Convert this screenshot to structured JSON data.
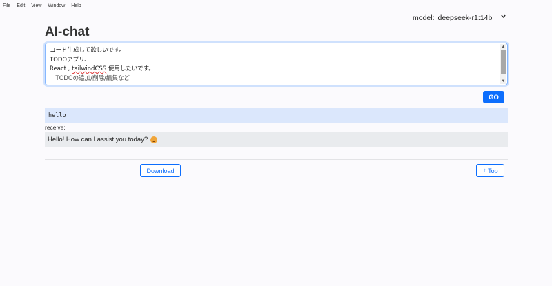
{
  "menu": [
    "File",
    "Edit",
    "View",
    "Window",
    "Help"
  ],
  "model": {
    "label": "model:",
    "value": "deepseek-r1:14b"
  },
  "title": "AI-chat",
  "prompt": {
    "lines": [
      "コード生成して欲しいです。",
      "TODOアプリ、",
      "React , ",
      "tailwindCSS",
      " 使用したいです。",
      "",
      "　TODOの追加/削除/編集など"
    ]
  },
  "go_label": "GO",
  "sent": "hello",
  "receive_label": "receive:",
  "reply": "Hello! How can I assist you today?",
  "download_label": "Download",
  "top_label": "Top"
}
